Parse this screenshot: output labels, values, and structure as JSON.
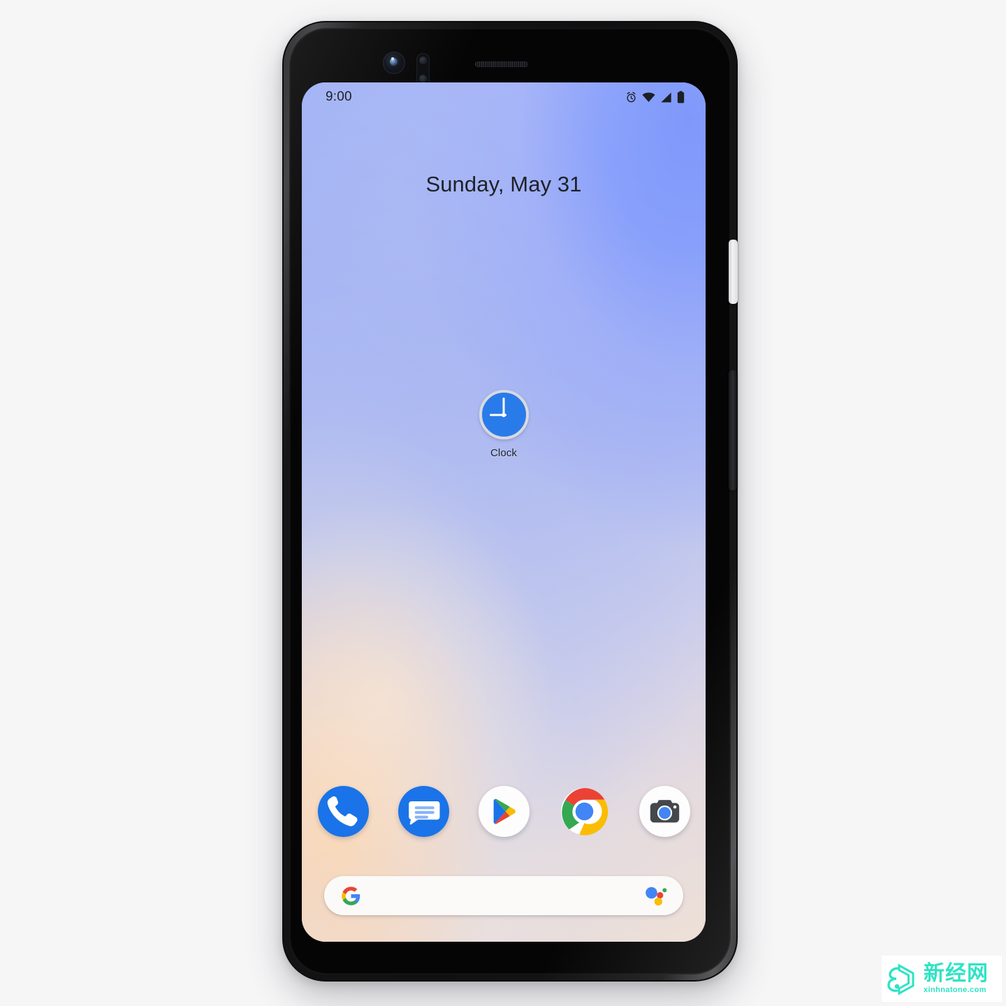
{
  "device": {
    "name": "Google Pixel 4",
    "hardware": {
      "front_camera": "front-camera",
      "proximity_sensor": "proximity-sensor",
      "earpiece": "earpiece-speaker",
      "power_button": "power-button",
      "volume_button": "volume-rocker"
    }
  },
  "statusbar": {
    "time": "9:00",
    "icons": [
      {
        "name": "alarm-icon",
        "label": "Alarm set"
      },
      {
        "name": "wifi-icon",
        "label": "Wi-Fi connected"
      },
      {
        "name": "cellular-signal-icon",
        "label": "Mobile signal full"
      },
      {
        "name": "battery-icon",
        "label": "Battery full"
      }
    ]
  },
  "homescreen": {
    "date_widget": "Sunday, May 31",
    "apps": [
      {
        "name": "clock",
        "label": "Clock",
        "icon": "clock-icon",
        "face_color": "#2a7bea",
        "rim_color": "#d8dade",
        "hands_color": "#ffffff",
        "time_shown": "9:00"
      }
    ],
    "wallpaper": {
      "name": "gradient-wallpaper",
      "colors": [
        "#6f8cfb",
        "#a0b0f6",
        "#c2c8ee",
        "#e4dbdf",
        "#fad6b2"
      ]
    }
  },
  "dock": {
    "items": [
      {
        "name": "phone-app",
        "label": "Phone",
        "icon": "phone-icon",
        "color": "#1a73e8"
      },
      {
        "name": "messages-app",
        "label": "Messages",
        "icon": "messages-icon",
        "color": "#1a73e8"
      },
      {
        "name": "play-store-app",
        "label": "Play Store",
        "icon": "play-store-icon",
        "color": "#fdfdfd"
      },
      {
        "name": "chrome-app",
        "label": "Chrome",
        "icon": "chrome-icon",
        "color": "#ea4335"
      },
      {
        "name": "camera-app",
        "label": "Camera",
        "icon": "camera-icon",
        "color": "#fdfdfd"
      }
    ]
  },
  "search": {
    "placeholder": "",
    "value": "",
    "google_logo": "google-g-icon",
    "assistant_icon": "google-assistant-icon",
    "assistant_colors": {
      "blue": "#4285f4",
      "red": "#ea4335",
      "yellow": "#fbbc05",
      "green": "#34a853"
    }
  },
  "watermark": {
    "brand_cn": "新经网",
    "brand_en": "xinhnatone.com",
    "color": "#2fe3c4"
  }
}
